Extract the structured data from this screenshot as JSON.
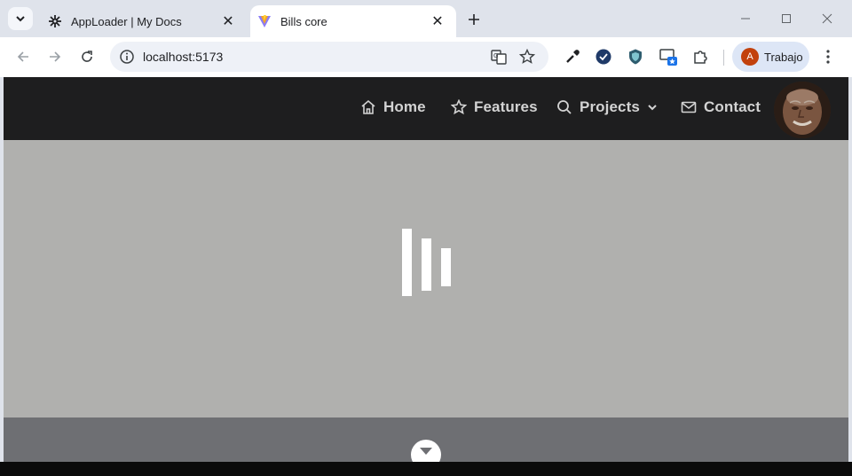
{
  "browser": {
    "tabs": [
      {
        "title": "AppLoader | My Docs",
        "active": false,
        "icon": "gear-bug-icon"
      },
      {
        "title": "Bills core",
        "active": true,
        "icon": "vite-logo-icon"
      }
    ],
    "address": "localhost:5173",
    "profile_name": "Trabajo",
    "profile_initial": "A",
    "profile_color": "#c2410c"
  },
  "site": {
    "nav": [
      {
        "label": "Home",
        "icon": "home-icon"
      },
      {
        "label": "Features",
        "icon": "star-icon"
      },
      {
        "label": "Projects",
        "icon": "search-icon",
        "dropdown": true
      },
      {
        "label": "Contact",
        "icon": "mail-icon"
      }
    ],
    "colors": {
      "nav_bg": "#1e1e1f",
      "hero_bg": "#b0b0ae",
      "footer_band": "#6e6f73",
      "nav_text": "#d3d3d3"
    },
    "loader": "three-bars-loading-icon",
    "scroll_hint": "chevron-down-icon"
  }
}
